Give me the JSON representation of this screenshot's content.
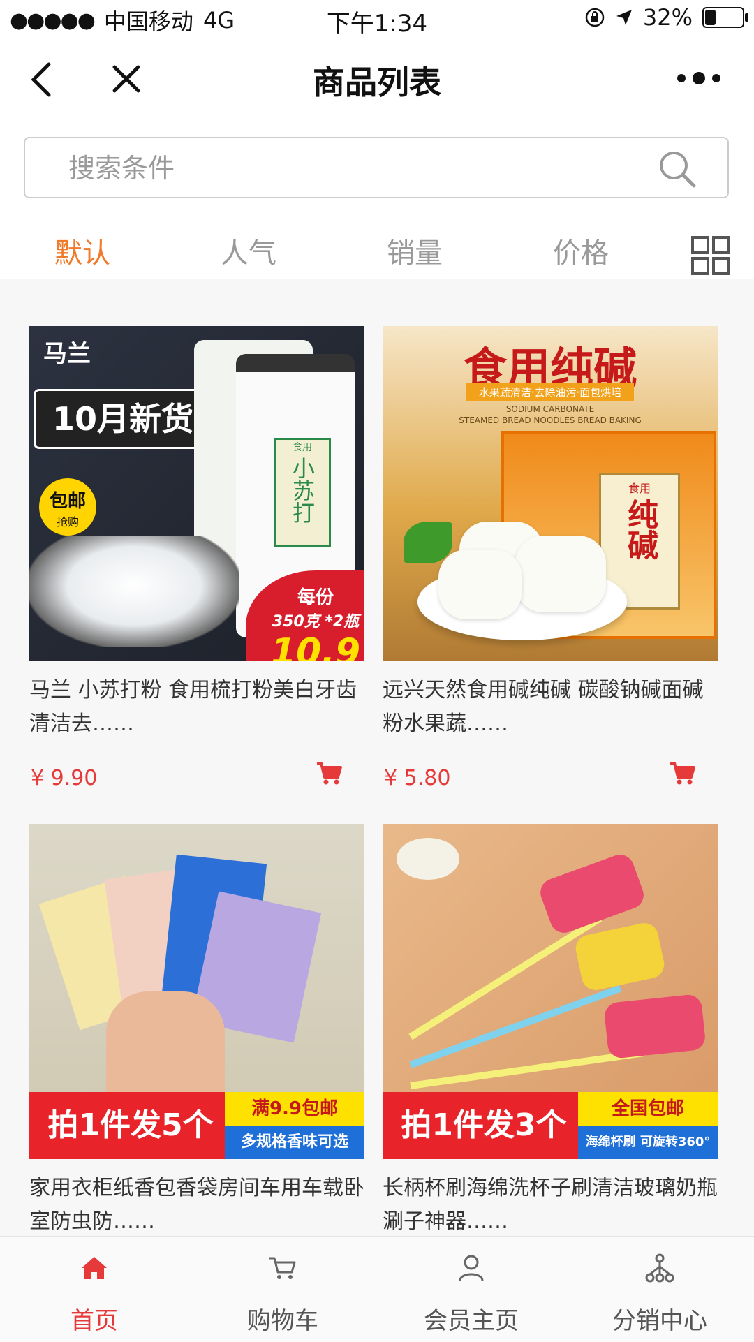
{
  "status": {
    "carrier": "中国移动",
    "network": "4G",
    "time": "下午1:34",
    "battery": "32%",
    "battery_level": 0.32
  },
  "nav": {
    "title": "商品列表"
  },
  "search": {
    "placeholder": "搜索条件"
  },
  "sort_tabs": [
    {
      "label": "默认",
      "active": true
    },
    {
      "label": "人气",
      "active": false
    },
    {
      "label": "销量",
      "active": false
    },
    {
      "label": "价格",
      "active": false
    }
  ],
  "products": [
    {
      "name": "马兰 小苏打粉 食用梳打粉美白牙齿清洁去……",
      "price": "¥ 9.90",
      "image_text": {
        "brand": "马兰",
        "badge": "10月新货",
        "tag": "包邮",
        "tag_sub": "抢购",
        "label": "小苏打",
        "label_sub": "食用",
        "promo1": "每份",
        "promo2": "350克 *2瓶",
        "promo_price": "10.9"
      }
    },
    {
      "name": "远兴天然食用碱纯碱 碳酸钠碱面碱粉水果蔬……",
      "price": "¥ 5.80",
      "image_text": {
        "headline": "食用纯碱",
        "sub": "水果蔬清洁·去除油污·面包烘培",
        "en1": "SODIUM CARBONATE",
        "en2": "STEAMED BREAD  NOODLES BREAD BAKING",
        "label": "纯碱",
        "label_sub": "食用"
      }
    },
    {
      "name": "家用衣柜纸香包香袋房间车用车载卧室防虫防……",
      "price": "",
      "image_text": {
        "banner": "拍1件发5个",
        "side1": "满9.9包邮",
        "side2": "多规格香味可选"
      }
    },
    {
      "name": "长柄杯刷海绵洗杯子刷清洁玻璃奶瓶涮子神器……",
      "price": "",
      "image_text": {
        "banner": "拍1件发3个",
        "side1": "全国包邮",
        "side2": "海绵杯刷 可旋转360°"
      }
    }
  ],
  "tabbar": [
    {
      "label": "首页",
      "icon": "home-icon",
      "active": true
    },
    {
      "label": "购物车",
      "icon": "cart-icon",
      "active": false
    },
    {
      "label": "会员主页",
      "icon": "user-icon",
      "active": false
    },
    {
      "label": "分销中心",
      "icon": "network-icon",
      "active": false
    }
  ],
  "colors": {
    "accent": "#f07a2a",
    "price": "#e63a3a",
    "border": "#cccccc"
  }
}
